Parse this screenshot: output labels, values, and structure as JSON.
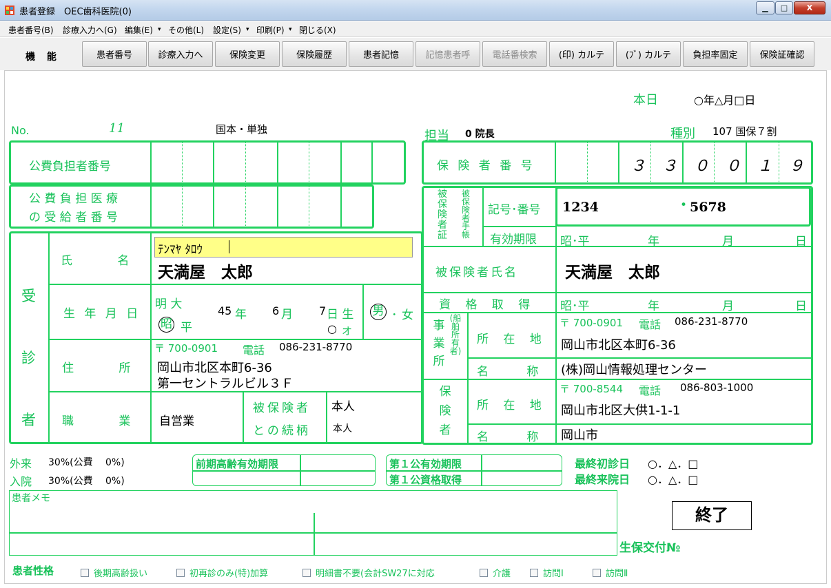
{
  "window": {
    "title": "患者登録　OEC歯科医院(0)",
    "min": "▁",
    "max": "□",
    "close": "X"
  },
  "menu": [
    "患者番号(B)",
    "診療入力へ(G)",
    "編集(E)",
    "▾",
    "その他(L)",
    "設定(S)",
    "▾",
    "印刷(P)",
    "▾",
    "閉じる(X)"
  ],
  "toolbar": {
    "label": "機 能",
    "buttons": [
      "患者番号",
      "診療入力へ",
      "保険変更",
      "保険履歴",
      "患者記憶",
      "記憶患者呼",
      "電話番検索",
      "(印) カルテ",
      "(ﾌﾞ) カルテ",
      "負担率固定",
      "保険証確認"
    ]
  },
  "header": {
    "today_label": "本日",
    "today_value": "○年△月□日",
    "no_label": "No.",
    "no_value": "11",
    "insurance_type": "国本・単独",
    "tanto_label": "担当",
    "tanto_value": "0 院長",
    "shubetsu_label": "種別",
    "shubetsu_value": "107 国保７割"
  },
  "public": {
    "num_label": "公費負担者番号",
    "recip_label1": "公 費 負 担 医 療",
    "recip_label2": "の 受 給 者 番 号"
  },
  "insurer": {
    "label": "保 険 者 番 号",
    "digits": [
      "３",
      "３",
      "０",
      "０",
      "１",
      "９"
    ]
  },
  "card": {
    "v1": "被保険者証",
    "v2": "被保険者手帳",
    "kigo_label": "記号･番号",
    "kigo_value": "1234",
    "bango_value": "5678",
    "bango_dot": "•",
    "expiry_label": "有効期限",
    "expiry_value": [
      "昭･平",
      "年",
      "月",
      "日"
    ],
    "holder_label": "被保険者氏名",
    "holder_value": "天満屋　太郎",
    "qual_label": "資 格 取 得",
    "qual_value": [
      "昭･平",
      "年",
      "月",
      "日"
    ]
  },
  "jigyosho": {
    "v1": "事業所",
    "v2": "(船舶所有者)",
    "postal": "〒 700-0901",
    "tel_label": "電話",
    "tel": "086-231-8770",
    "addr_label": "所 在 地",
    "addr": "岡山市北区本町6-36",
    "name_label": "名 称",
    "name": "(株)岡山情報処理センター"
  },
  "hokensha": {
    "v": "保険者",
    "postal": "〒 700-8544",
    "tel_label": "電話",
    "tel": "086-803-1000",
    "addr_label": "所 在 地",
    "addr": "岡山市北区大供1-1-1",
    "name_label": "名 称",
    "name": "岡山市"
  },
  "patient": {
    "side": "受診者",
    "name_label": "氏 名",
    "kana": "ﾃﾝﾏﾔ ﾀﾛｳ",
    "name": "天満屋　太郎",
    "birth_label": "生 年 月 日",
    "era1": "明 大",
    "era2": "昭",
    "era3": "平",
    "year": "45",
    "year_u": "年",
    "month": "6",
    "month_u": "月",
    "day": "7",
    "day_u": "日 生",
    "male": "男",
    "sep": "･",
    "female": "女",
    "o": "○",
    "oi": "オ",
    "addr_label": "住 所",
    "postal": "〒 700-0901",
    "tel_label": "電話",
    "tel": "086-231-8770",
    "addr1": "岡山市北区本町6-36",
    "addr2": "第一セントラルビル３Ｆ",
    "job_label": "職 業",
    "job": "自営業",
    "rel_label1": "被保険者",
    "rel_label2": "との続柄",
    "rel1": "本人",
    "rel2": "本人"
  },
  "bottom": {
    "gairai_label": "外来",
    "gairai": "30%(公費　 0%)",
    "nyuin_label": "入院",
    "nyuin": "30%(公費　 0%)",
    "zenki": "前期高齢有効期限",
    "dai1_valid": "第１公有効期限",
    "dai1_qual": "第１公資格取得",
    "saisho_label": "最終初診日",
    "saisho": "○．△．□",
    "raiin_label": "最終来院日",
    "raiin": "○．△．□",
    "memo_label": "患者メモ",
    "end": "終了",
    "seiho": "生保交付№",
    "traits_label": "患者性格",
    "traits": [
      "後期高齢扱い",
      "初再診のみ(特)加算",
      "明細書不要(会計SW27に対応",
      "介護",
      "訪問Ⅰ",
      "訪問Ⅱ"
    ]
  }
}
